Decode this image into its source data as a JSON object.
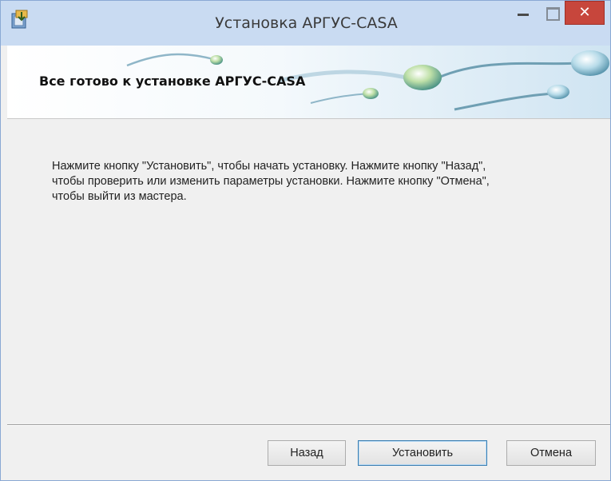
{
  "window": {
    "title": "Установка АРГУС-CASA",
    "close_glyph": "✕",
    "icons": [
      "installer-app-icon",
      "minimize-icon",
      "maximize-icon",
      "close-icon"
    ]
  },
  "banner": {
    "title": "Все готово к установке АРГУС-CASA"
  },
  "content": {
    "line1": "Нажмите кнопку \"Установить\", чтобы начать установку. Нажмите кнопку \"Назад\",",
    "line2": "чтобы проверить или изменить параметры установки. Нажмите кнопку \"Отмена\",",
    "line3": "чтобы выйти из мастера."
  },
  "buttons": {
    "back": "Назад",
    "install": "Установить",
    "cancel": "Отмена"
  },
  "colors": {
    "titlebar": "#c9dbf2",
    "close_button": "#c7463c",
    "focused_button_border": "#3c7fb1"
  }
}
